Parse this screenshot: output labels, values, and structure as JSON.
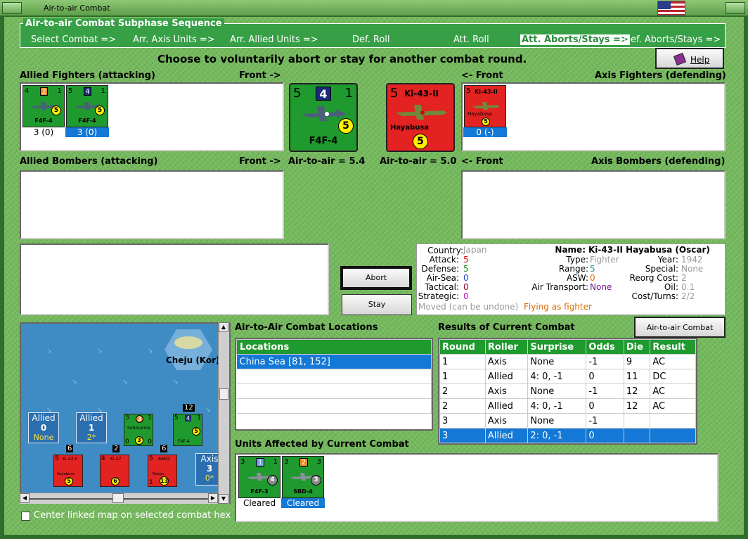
{
  "window": {
    "title": "Air-to-air Combat"
  },
  "sequence": {
    "caption": "Air-to-air Combat Subphase Sequence",
    "steps": [
      "Select Combat =>",
      "Arr. Axis Units =>",
      "Arr. Allied Units =>",
      "Def. Roll",
      "Att. Roll",
      "Att. Aborts/Stays =>",
      "Def. Aborts/Stays =>"
    ],
    "active_index": 5
  },
  "instruction": "Choose to voluntarily abort or stay for another combat round.",
  "help_label": "Help",
  "allied_fighters": {
    "label": "Allied Fighters (attacking)",
    "front": "Front ->",
    "units": [
      {
        "air": "4",
        "att": "2",
        "def": "1",
        "type": "F4F-4",
        "move": "5",
        "caption": "3 (0)",
        "selected": false
      },
      {
        "air": "5",
        "att": "4",
        "def": "1",
        "type": "F4F-4",
        "move": "5",
        "caption": "3 (0)",
        "selected": true
      }
    ]
  },
  "axis_fighters": {
    "label": "Axis Fighters (defending)",
    "front": "<- Front",
    "units": [
      {
        "air": "5",
        "name": "Ki-43-II",
        "sub": "Hayabusa",
        "move": "5",
        "caption": "0 (-)",
        "selected": true
      }
    ]
  },
  "allied_bombers": {
    "label": "Allied Bombers (attacking)",
    "front": "Front ->"
  },
  "axis_bombers": {
    "label": "Axis Bombers (defending)",
    "front": "<- Front"
  },
  "attacker_big": {
    "air": "5",
    "att": "4",
    "def": "1",
    "type": "F4F-4",
    "move": "5",
    "air_to_air": "Air-to-air = 5.4"
  },
  "defender_big": {
    "air": "5",
    "name": "Ki-43-II",
    "sub": "Hayabusa",
    "move": "5",
    "air_to_air": "Air-to-air = 5.0"
  },
  "buttons": {
    "abort": "Abort",
    "stay": "Stay",
    "chart": "Air-to-air Combat Chart"
  },
  "info": {
    "country_k": "Country:",
    "country_v": "Japan",
    "attack_k": "Attack:",
    "attack_v": "5",
    "defense_k": "Defense:",
    "defense_v": "5",
    "airsea_k": "Air-Sea:",
    "airsea_v": "0",
    "tactical_k": "Tactical:",
    "tactical_v": "0",
    "strategic_k": "Strategic:",
    "strategic_v": "0",
    "name_k": "Name:",
    "name_v": "Ki-43-II Hayabusa (Oscar)",
    "type_k": "Type:",
    "type_v": "Fighter",
    "range_k": "Range:",
    "range_v": "5",
    "asw_k": "ASW:",
    "asw_v": "0",
    "transport_k": "Air Transport:",
    "transport_v": "None",
    "year_k": "Year:",
    "year_v": "1942",
    "special_k": "Special:",
    "special_v": "None",
    "reorg_k": "Reorg Cost:",
    "reorg_v": "2",
    "oil_k": "Oil:",
    "oil_v": "0.1",
    "cost_k": "Cost/Turns:",
    "cost_v": "2/2",
    "moved": "Moved (can be undone)",
    "flying": "Flying as fighter"
  },
  "map": {
    "hex_label": "Cheju (Kor)",
    "allied_box": {
      "label": "Allied",
      "value": "0",
      "sub": "None"
    },
    "allied_box2": {
      "label": "Allied",
      "value": "1",
      "sub": "2*"
    },
    "axis_box": {
      "label": "Axis",
      "value": "3",
      "sub": "0*"
    },
    "submarine": {
      "tl": "3",
      "tc": "3",
      "tr": "1",
      "label": "Submarine",
      "bl": "0",
      "bc": "3",
      "br": "0"
    },
    "f4f": {
      "stack": "12",
      "tl": "5",
      "tc": "4",
      "tr": "1",
      "label": "F4F-4",
      "move": "5"
    },
    "ki43": {
      "stack": "6",
      "tl": "5",
      "name": "Ki-43-II",
      "label": "Hayabusa",
      "move": "5"
    },
    "ki27": {
      "stack": "2",
      "tl": "4",
      "name": "Ki-27",
      "move": "6"
    },
    "a6m2": {
      "stack": "6",
      "tl": "5",
      "name": "A6M2",
      "label": "Reisen",
      "bl": "1",
      "move": "13"
    }
  },
  "center_map_label": "Center linked map on selected combat hex",
  "locations": {
    "title": "Air-to-Air Combat Locations",
    "header": "Locations",
    "rows": [
      "China Sea [81, 152]"
    ]
  },
  "results": {
    "title": "Results of Current Combat",
    "headers": [
      "Round",
      "Roller",
      "Surprise",
      "Odds",
      "Die",
      "Result"
    ],
    "rows": [
      [
        "1",
        "Axis",
        "None",
        "-1",
        "9",
        "AC"
      ],
      [
        "1",
        "Allied",
        "4: 0, -1",
        "0",
        "11",
        "DC"
      ],
      [
        "2",
        "Axis",
        "None",
        "-1",
        "12",
        "AC"
      ],
      [
        "2",
        "Allied",
        "4: 0, -1",
        "0",
        "12",
        "AC"
      ],
      [
        "3",
        "Axis",
        "None",
        "-1",
        "",
        ""
      ],
      [
        "3",
        "Allied",
        "2: 0, -1",
        "0",
        "",
        ""
      ]
    ],
    "selected_row": 5
  },
  "affected": {
    "title": "Units Affected by Current Combat",
    "units": [
      {
        "tl": "3",
        "tc": "1",
        "tr": "1",
        "type": "F4F-3",
        "move": "4",
        "caption": "Cleared",
        "selected": false
      },
      {
        "tl": "3",
        "tc": "2",
        "tr": "3",
        "type": "SBD-4",
        "move": "3",
        "caption": "Cleared",
        "selected": true
      }
    ]
  },
  "colors": {
    "allied": "#1f9a2e",
    "axis": "#e32222",
    "selection": "#1378d6",
    "background": "#74b95c"
  }
}
